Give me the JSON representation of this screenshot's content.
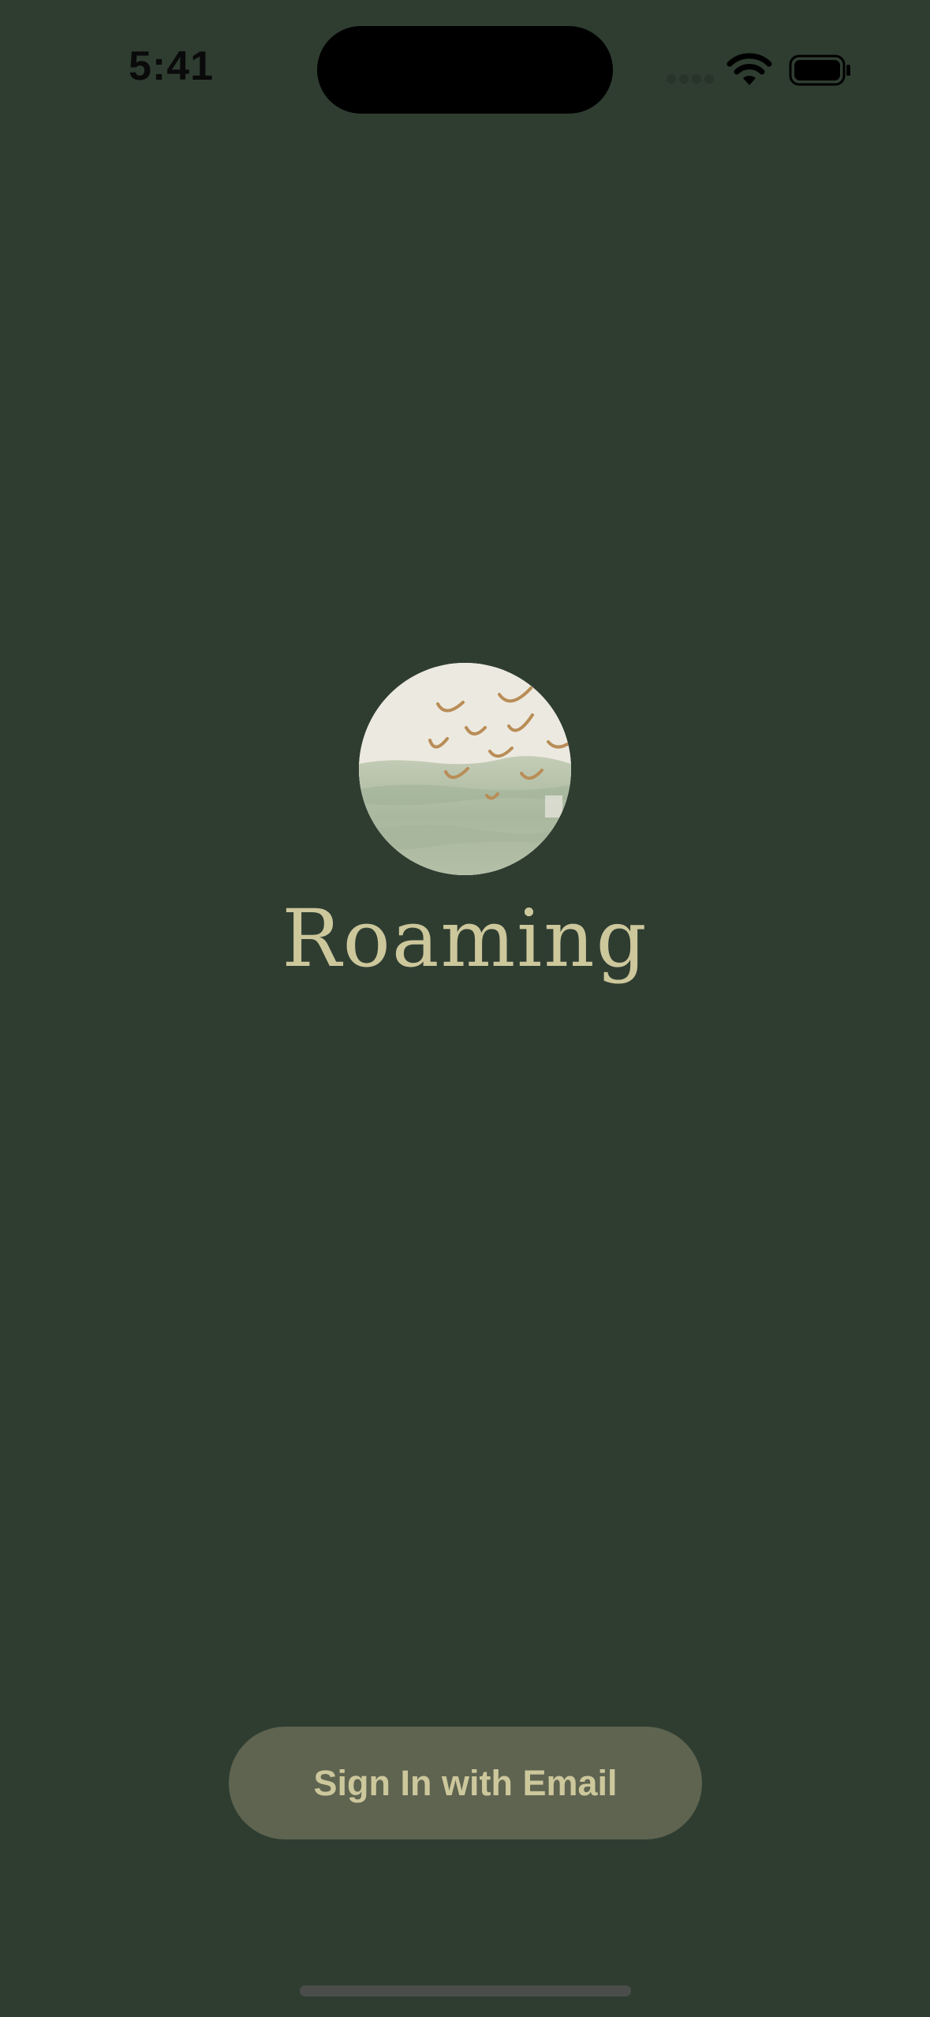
{
  "status_bar": {
    "time": "5:41",
    "icons": [
      "cellular-signal-icon",
      "wifi-icon",
      "battery-icon"
    ]
  },
  "app": {
    "title": "Roaming",
    "logo": "roaming-logo-birds-over-water"
  },
  "actions": {
    "sign_in_label": "Sign In with Email"
  },
  "colors": {
    "background": "#2f3d31",
    "title": "#cdc79c",
    "button_bg": "#5e6450",
    "button_text": "#cdc79c",
    "bird_marks": "#b98d57"
  }
}
